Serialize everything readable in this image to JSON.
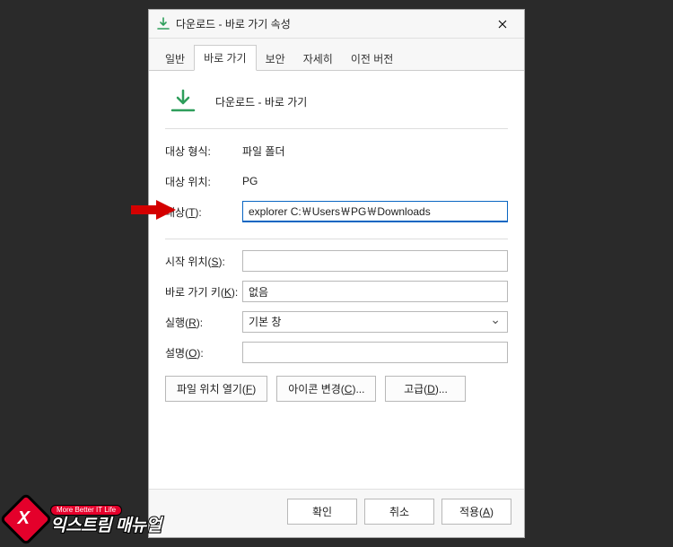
{
  "title": "다운로드 - 바로 가기 속성",
  "tabs": {
    "general": "일반",
    "shortcut": "바로 가기",
    "security": "보안",
    "details": "자세히",
    "previous": "이전 버전"
  },
  "hero": {
    "name": "다운로드 - 바로 가기"
  },
  "fields": {
    "targetType": {
      "label": "대상 형식:",
      "value": "파일 폴더"
    },
    "location": {
      "label": "대상 위치:",
      "value": "PG"
    },
    "target": {
      "label": "대상(T):",
      "value": "explorer C:￦Users￦PG￦Downloads"
    },
    "startIn": {
      "label": "시작 위치(S):",
      "value": ""
    },
    "shortcutKey": {
      "label": "바로 가기 키(K):",
      "value": "없음"
    },
    "run": {
      "label": "실행(R):",
      "selected": "기본 창"
    },
    "comment": {
      "label": "설명(O):",
      "value": ""
    }
  },
  "buttons": {
    "openFile": "파일 위치 열기(F)",
    "changeIcon": "아이콘 변경(C)...",
    "advanced": "고급(D)...",
    "ok": "확인",
    "cancel": "취소",
    "apply": "적용(A)"
  },
  "logo": {
    "tagline": "More Better IT Life",
    "brand": "익스트림 매뉴얼",
    "mark": "X"
  }
}
